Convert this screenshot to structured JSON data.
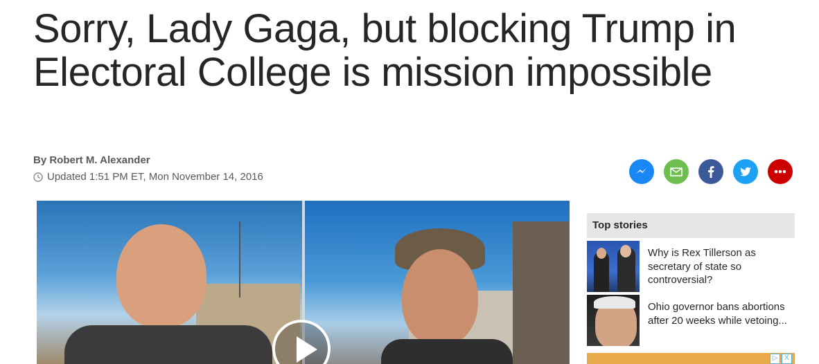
{
  "article": {
    "headline": "Sorry, Lady Gaga, but blocking Trump in Electoral College is mission impossible",
    "byline": "By Robert M. Alexander",
    "updated": "Updated 1:51 PM ET, Mon November 14, 2016"
  },
  "share": [
    {
      "icon": "messenger-icon",
      "color": "#1a87f6"
    },
    {
      "icon": "email-icon",
      "color": "#6cbf4c"
    },
    {
      "icon": "facebook-icon",
      "color": "#3b5998"
    },
    {
      "icon": "twitter-icon",
      "color": "#1da1f2"
    },
    {
      "icon": "more-icon",
      "color": "#cc0000"
    }
  ],
  "top_stories": {
    "header": "Top stories",
    "items": [
      {
        "title": "Why is Rex Tillerson as secretary of state so controversial?"
      },
      {
        "title": "Ohio governor bans abortions after 20 weeks while vetoing..."
      }
    ]
  },
  "ad": {
    "close_label": "X"
  }
}
